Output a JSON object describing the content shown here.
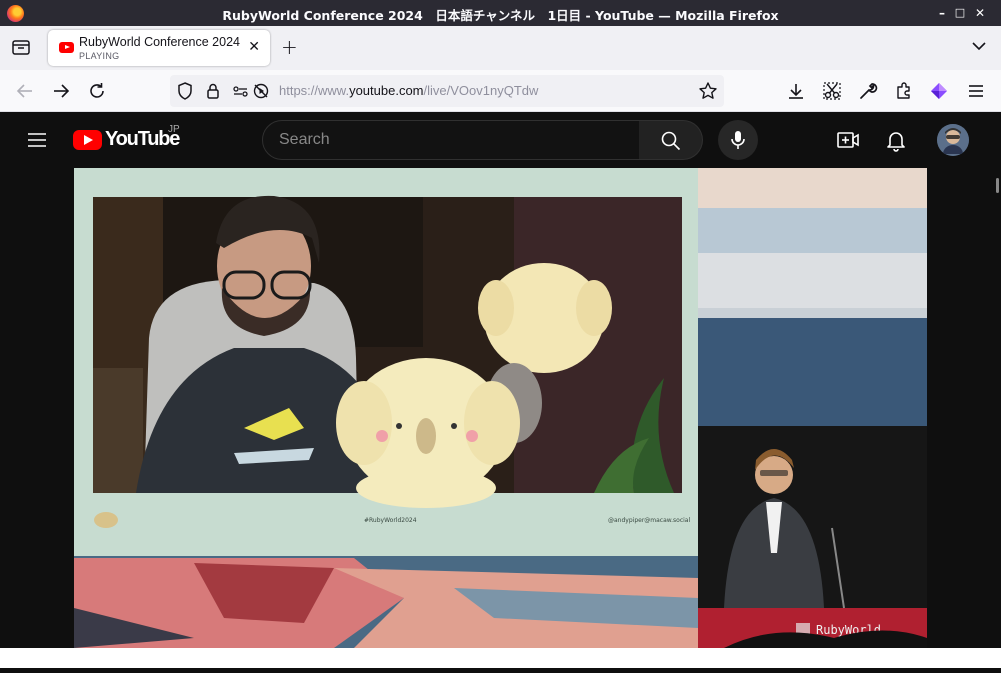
{
  "window": {
    "title": "RubyWorld Conference 2024　日本語チャンネル　1日目 - YouTube — Mozilla Firefox",
    "controls": {
      "minimize": "–",
      "maximize": "□",
      "close": "✕"
    }
  },
  "tabs": [
    {
      "title": "RubyWorld Conference 2024",
      "subtitle": "PLAYING",
      "close": "✕"
    }
  ],
  "tabstrip": {
    "new_tab": "+"
  },
  "navbar": {
    "url_prefix": "https://www.",
    "url_host": "youtube.com",
    "url_path": "/live/VOov1nyQTdw"
  },
  "youtube": {
    "logo_text": "YouTube",
    "region": "JP",
    "search_placeholder": "Search"
  },
  "video": {
    "hashtag": "#RubyWorld2024",
    "handle": "@andypiper@macaw.social",
    "stage_sign": "RubyWorld"
  },
  "colors": {
    "youtube_red": "#ff0000",
    "slide_bg": "#c7dcd0",
    "titlebar": "#2b2a33"
  }
}
